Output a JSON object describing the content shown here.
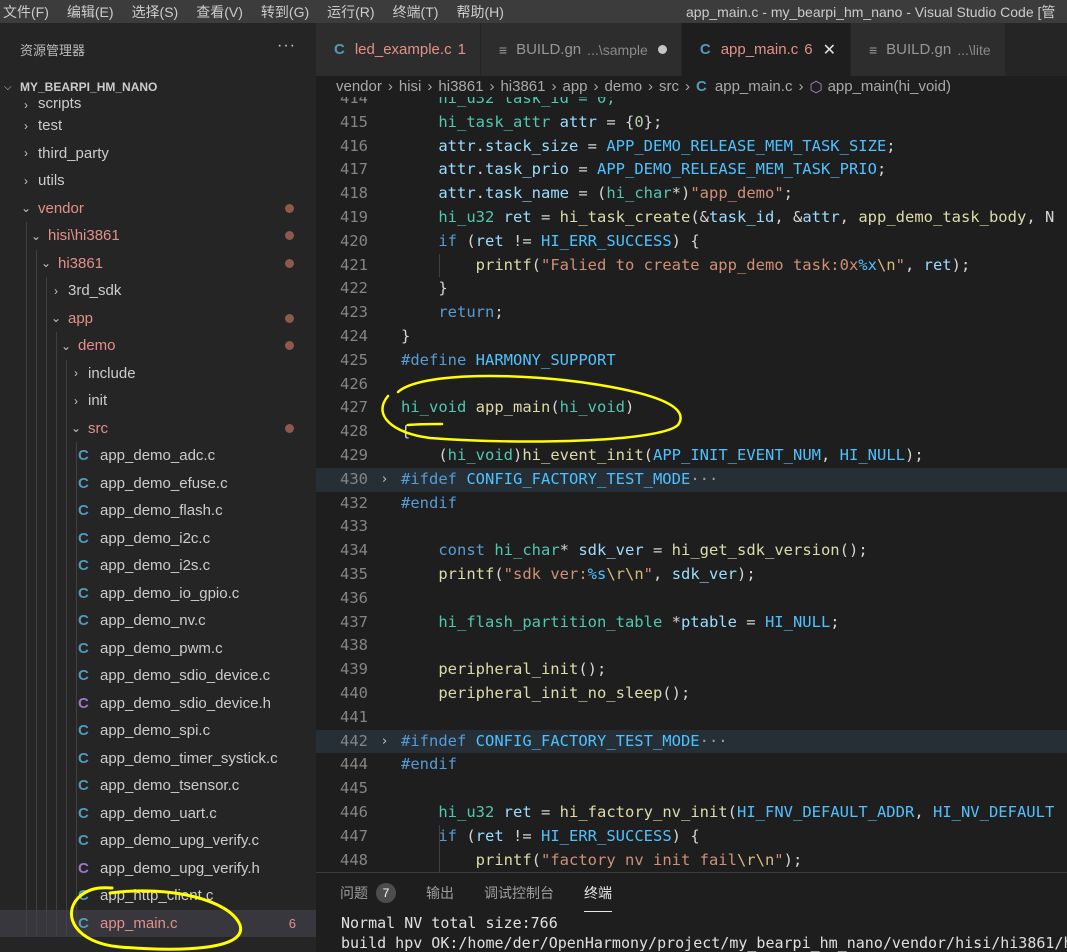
{
  "menu": [
    "文件(F)",
    "编辑(E)",
    "选择(S)",
    "查看(V)",
    "转到(G)",
    "运行(R)",
    "终端(T)",
    "帮助(H)"
  ],
  "window_title": "app_main.c - my_bearpi_hm_nano - Visual Studio Code [管",
  "explorer": {
    "title": "资源管理器",
    "more": "···",
    "workspace": "MY_BEARPI_HM_NANO",
    "items": [
      {
        "label": "scripts",
        "level": 1,
        "type": "folder",
        "open": false,
        "partial": true
      },
      {
        "label": "test",
        "level": 1,
        "type": "folder",
        "open": false
      },
      {
        "label": "third_party",
        "level": 1,
        "type": "folder",
        "open": false
      },
      {
        "label": "utils",
        "level": 1,
        "type": "folder",
        "open": false
      },
      {
        "label": "vendor",
        "level": 1,
        "type": "folder",
        "open": true,
        "modified": true
      },
      {
        "label": "hisi",
        "label2": "hi3861",
        "level": 2,
        "type": "folder",
        "open": true,
        "modified": true
      },
      {
        "label": "hi3861",
        "level": 3,
        "type": "folder",
        "open": true,
        "modified": true
      },
      {
        "label": "3rd_sdk",
        "level": 4,
        "type": "folder",
        "open": false
      },
      {
        "label": "app",
        "level": 4,
        "type": "folder",
        "open": true,
        "modified": true
      },
      {
        "label": "demo",
        "level": 5,
        "type": "folder",
        "open": true,
        "modified": true
      },
      {
        "label": "include",
        "level": 6,
        "type": "folder",
        "open": false
      },
      {
        "label": "init",
        "level": 6,
        "type": "folder",
        "open": false
      },
      {
        "label": "src",
        "level": 6,
        "type": "folder",
        "open": true,
        "modified": true
      },
      {
        "label": "app_demo_adc.c",
        "level": 7,
        "type": "c"
      },
      {
        "label": "app_demo_efuse.c",
        "level": 7,
        "type": "c"
      },
      {
        "label": "app_demo_flash.c",
        "level": 7,
        "type": "c"
      },
      {
        "label": "app_demo_i2c.c",
        "level": 7,
        "type": "c"
      },
      {
        "label": "app_demo_i2s.c",
        "level": 7,
        "type": "c"
      },
      {
        "label": "app_demo_io_gpio.c",
        "level": 7,
        "type": "c"
      },
      {
        "label": "app_demo_nv.c",
        "level": 7,
        "type": "c"
      },
      {
        "label": "app_demo_pwm.c",
        "level": 7,
        "type": "c"
      },
      {
        "label": "app_demo_sdio_device.c",
        "level": 7,
        "type": "c"
      },
      {
        "label": "app_demo_sdio_device.h",
        "level": 7,
        "type": "h"
      },
      {
        "label": "app_demo_spi.c",
        "level": 7,
        "type": "c"
      },
      {
        "label": "app_demo_timer_systick.c",
        "level": 7,
        "type": "c"
      },
      {
        "label": "app_demo_tsensor.c",
        "level": 7,
        "type": "c"
      },
      {
        "label": "app_demo_uart.c",
        "level": 7,
        "type": "c"
      },
      {
        "label": "app_demo_upg_verify.c",
        "level": 7,
        "type": "c"
      },
      {
        "label": "app_demo_upg_verify.h",
        "level": 7,
        "type": "h"
      },
      {
        "label": "app_http_client.c",
        "level": 7,
        "type": "c"
      },
      {
        "label": "app_main.c",
        "level": 7,
        "type": "c",
        "selected": true,
        "modified": true,
        "badge": "6"
      }
    ]
  },
  "tabs": [
    {
      "icon": "C",
      "label": "led_example.c",
      "count": "1",
      "modified": true
    },
    {
      "icon": "gn",
      "label": "BUILD.gn",
      "suffix": "...\\sample",
      "dirty": true
    },
    {
      "icon": "C",
      "label": "app_main.c",
      "count": "6",
      "modified": true,
      "active": true,
      "close": "✕"
    },
    {
      "icon": "gn",
      "label": "BUILD.gn",
      "suffix": "...\\lite"
    }
  ],
  "breadcrumb": [
    "vendor",
    "hisi",
    "hi3861",
    "hi3861",
    "app",
    "demo",
    "src",
    "app_main.c",
    "app_main(hi_void)"
  ],
  "code": [
    {
      "n": "414",
      "t": [
        [
          "    ",
          ""
        ],
        [
          "hi_u32 task_id = 0;",
          "ty"
        ]
      ]
    },
    {
      "n": "415",
      "t": [
        [
          "    ",
          ""
        ],
        [
          "hi_task_attr",
          "ty"
        ],
        [
          " ",
          ""
        ],
        [
          "attr",
          "va"
        ],
        [
          " = {",
          ""
        ],
        [
          "0",
          "nu"
        ],
        [
          "};",
          ""
        ]
      ]
    },
    {
      "n": "416",
      "t": [
        [
          "    ",
          ""
        ],
        [
          "attr",
          "va"
        ],
        [
          ".",
          ""
        ],
        [
          "stack_size",
          "va"
        ],
        [
          " = ",
          ""
        ],
        [
          "APP_DEMO_RELEASE_MEM_TASK_SIZE",
          "co"
        ],
        [
          ";",
          ""
        ]
      ]
    },
    {
      "n": "417",
      "t": [
        [
          "    ",
          ""
        ],
        [
          "attr",
          "va"
        ],
        [
          ".",
          ""
        ],
        [
          "task_prio",
          "va"
        ],
        [
          " = ",
          ""
        ],
        [
          "APP_DEMO_RELEASE_MEM_TASK_PRIO",
          "co"
        ],
        [
          ";",
          ""
        ]
      ]
    },
    {
      "n": "418",
      "t": [
        [
          "    ",
          ""
        ],
        [
          "attr",
          "va"
        ],
        [
          ".",
          ""
        ],
        [
          "task_name",
          "va"
        ],
        [
          " = (",
          ""
        ],
        [
          "hi_char",
          "ty"
        ],
        [
          "*)",
          ""
        ],
        [
          "\"app_demo\"",
          "st"
        ],
        [
          ";",
          ""
        ]
      ]
    },
    {
      "n": "419",
      "t": [
        [
          "    ",
          ""
        ],
        [
          "hi_u32",
          "ty"
        ],
        [
          " ",
          ""
        ],
        [
          "ret",
          "va"
        ],
        [
          " = ",
          ""
        ],
        [
          "hi_task_create",
          "fn"
        ],
        [
          "(&",
          ""
        ],
        [
          "task_id",
          "va"
        ],
        [
          ", &",
          ""
        ],
        [
          "attr",
          "va"
        ],
        [
          ", ",
          ""
        ],
        [
          "app_demo_task_body",
          "fn"
        ],
        [
          ", N",
          ""
        ]
      ]
    },
    {
      "n": "420",
      "t": [
        [
          "    ",
          ""
        ],
        [
          "if",
          "kw"
        ],
        [
          " (",
          ""
        ],
        [
          "ret",
          "va"
        ],
        [
          " != ",
          ""
        ],
        [
          "HI_ERR_SUCCESS",
          "co"
        ],
        [
          ") {",
          ""
        ]
      ]
    },
    {
      "n": "421",
      "t": [
        [
          "        ",
          ""
        ],
        [
          "printf",
          "fn"
        ],
        [
          "(",
          ""
        ],
        [
          "\"Falied to create app_demo task:0x",
          "st"
        ],
        [
          "%x",
          "co"
        ],
        [
          "\\n",
          "es"
        ],
        [
          "\"",
          "st"
        ],
        [
          ", ",
          ""
        ],
        [
          "ret",
          "va"
        ],
        [
          ");",
          ""
        ]
      ]
    },
    {
      "n": "422",
      "t": [
        [
          "    }",
          ""
        ]
      ]
    },
    {
      "n": "423",
      "t": [
        [
          "    ",
          ""
        ],
        [
          "return",
          "kw"
        ],
        [
          ";",
          ""
        ]
      ]
    },
    {
      "n": "424",
      "t": [
        [
          "}",
          ""
        ]
      ]
    },
    {
      "n": "425",
      "t": [
        [
          "#define",
          "kw"
        ],
        [
          " ",
          ""
        ],
        [
          "HARMONY_SUPPORT",
          "co"
        ]
      ]
    },
    {
      "n": "426",
      "t": []
    },
    {
      "n": "427",
      "t": [
        [
          "hi_void",
          "ty"
        ],
        [
          " ",
          ""
        ],
        [
          "app_main",
          "fn"
        ],
        [
          "(",
          ""
        ],
        [
          "hi_void",
          "ty"
        ],
        [
          ")",
          ""
        ]
      ]
    },
    {
      "n": "428",
      "t": [
        [
          "{",
          ""
        ]
      ]
    },
    {
      "n": "429",
      "t": [
        [
          "    (",
          ""
        ],
        [
          "hi_void",
          "ty"
        ],
        [
          ")",
          ""
        ],
        [
          "hi_event_init",
          "fn"
        ],
        [
          "(",
          ""
        ],
        [
          "APP_INIT_EVENT_NUM",
          "co"
        ],
        [
          ", ",
          ""
        ],
        [
          "HI_NULL",
          "co"
        ],
        [
          ");",
          ""
        ]
      ]
    },
    {
      "n": "430",
      "fold": "›",
      "hl": true,
      "t": [
        [
          "#ifdef",
          "kw"
        ],
        [
          " ",
          ""
        ],
        [
          "CONFIG_FACTORY_TEST_MODE",
          "co"
        ],
        [
          "···",
          "el"
        ]
      ]
    },
    {
      "n": "432",
      "t": [
        [
          "#endif",
          "kw"
        ]
      ]
    },
    {
      "n": "433",
      "t": []
    },
    {
      "n": "434",
      "t": [
        [
          "    ",
          ""
        ],
        [
          "const",
          "kw"
        ],
        [
          " ",
          ""
        ],
        [
          "hi_char",
          "ty"
        ],
        [
          "* ",
          ""
        ],
        [
          "sdk_ver",
          "va"
        ],
        [
          " = ",
          ""
        ],
        [
          "hi_get_sdk_version",
          "fn"
        ],
        [
          "();",
          ""
        ]
      ]
    },
    {
      "n": "435",
      "t": [
        [
          "    ",
          ""
        ],
        [
          "printf",
          "fn"
        ],
        [
          "(",
          ""
        ],
        [
          "\"sdk ver:",
          "st"
        ],
        [
          "%s",
          "co"
        ],
        [
          "\\r\\n",
          "es"
        ],
        [
          "\"",
          "st"
        ],
        [
          ", ",
          ""
        ],
        [
          "sdk_ver",
          "va"
        ],
        [
          ");",
          ""
        ]
      ]
    },
    {
      "n": "436",
      "t": []
    },
    {
      "n": "437",
      "t": [
        [
          "    ",
          ""
        ],
        [
          "hi_flash_partition_table",
          "ty"
        ],
        [
          " *",
          ""
        ],
        [
          "ptable",
          "va"
        ],
        [
          " = ",
          ""
        ],
        [
          "HI_NULL",
          "co"
        ],
        [
          ";",
          ""
        ]
      ]
    },
    {
      "n": "438",
      "t": []
    },
    {
      "n": "439",
      "t": [
        [
          "    ",
          ""
        ],
        [
          "peripheral_init",
          "fn"
        ],
        [
          "();",
          ""
        ]
      ]
    },
    {
      "n": "440",
      "t": [
        [
          "    ",
          ""
        ],
        [
          "peripheral_init_no_sleep",
          "fn"
        ],
        [
          "();",
          ""
        ]
      ]
    },
    {
      "n": "441",
      "t": []
    },
    {
      "n": "442",
      "fold": "›",
      "hl": true,
      "t": [
        [
          "#ifndef",
          "kw"
        ],
        [
          " ",
          ""
        ],
        [
          "CONFIG_FACTORY_TEST_MODE",
          "co"
        ],
        [
          "···",
          "el"
        ]
      ]
    },
    {
      "n": "444",
      "t": [
        [
          "#endif",
          "kw"
        ]
      ]
    },
    {
      "n": "445",
      "t": []
    },
    {
      "n": "446",
      "t": [
        [
          "    ",
          ""
        ],
        [
          "hi_u32",
          "ty"
        ],
        [
          " ",
          ""
        ],
        [
          "ret",
          "va"
        ],
        [
          " = ",
          ""
        ],
        [
          "hi_factory_nv_init",
          "fn"
        ],
        [
          "(",
          ""
        ],
        [
          "HI_FNV_DEFAULT_ADDR",
          "co"
        ],
        [
          ", ",
          ""
        ],
        [
          "HI_NV_DEFAULT",
          "co"
        ]
      ]
    },
    {
      "n": "447",
      "t": [
        [
          "    ",
          ""
        ],
        [
          "if",
          "kw"
        ],
        [
          " (",
          ""
        ],
        [
          "ret",
          "va"
        ],
        [
          " != ",
          ""
        ],
        [
          "HI_ERR_SUCCESS",
          "co"
        ],
        [
          ") {",
          ""
        ]
      ]
    },
    {
      "n": "448",
      "t": [
        [
          "        ",
          ""
        ],
        [
          "printf",
          "fn"
        ],
        [
          "(",
          ""
        ],
        [
          "\"factory nv init fail",
          "st"
        ],
        [
          "\\r\\n",
          "es"
        ],
        [
          "\"",
          "st"
        ],
        [
          ");",
          ""
        ]
      ]
    }
  ],
  "colors": {
    "kw": "#569cd6",
    "ty": "#4ec9b0",
    "fn": "#dcdcaa",
    "va": "#9cdcfe",
    "co": "#4fc1ff",
    "st": "#ce9178",
    "es": "#d7ba7d",
    "nu": "#b5cea8",
    "el": "#9b9b9b",
    "c_icon": "#519aba",
    "h_icon": "#a074c4",
    "annotation": "#ffff00"
  },
  "panel": {
    "tabs": [
      {
        "label": "问题",
        "count": "7"
      },
      {
        "label": "输出"
      },
      {
        "label": "调试控制台"
      },
      {
        "label": "终端",
        "active": true
      }
    ],
    "terminal": [
      "Normal NV total size:766",
      "build hpv OK:/home/der/OpenHarmony/project/my_bearpi_hm_nano/vendor/hisi/hi3861/h"
    ]
  }
}
